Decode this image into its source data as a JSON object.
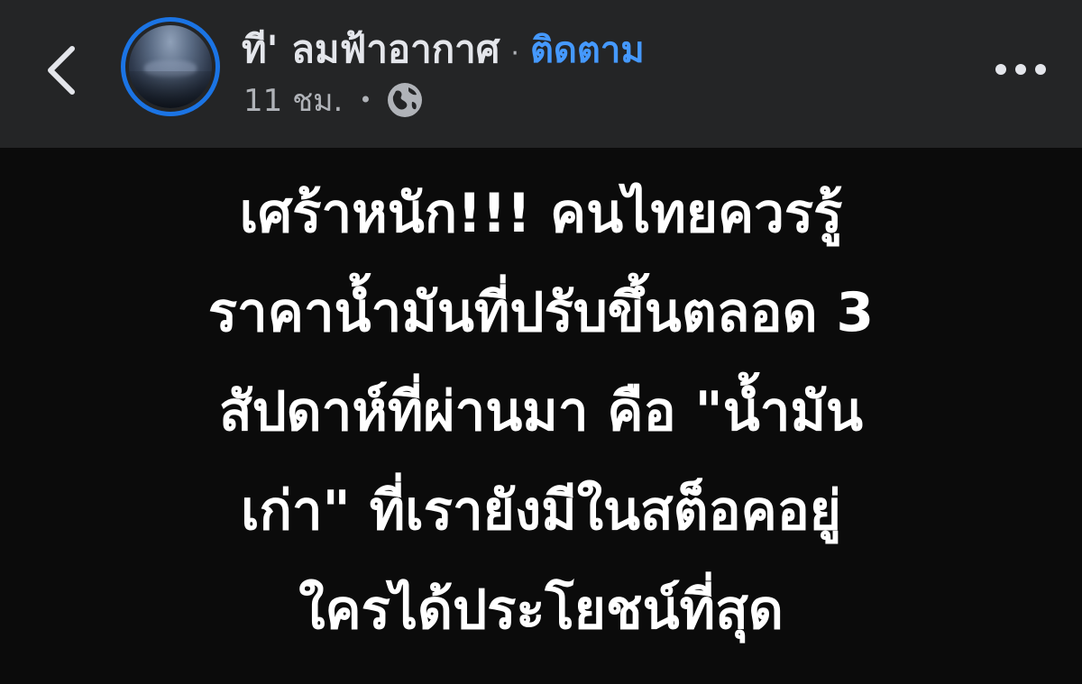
{
  "header": {
    "page_name": "ที' ลมฟ้าอากาศ",
    "separator": "·",
    "follow_label": "ติดตาม",
    "timestamp": "11 ชม.",
    "meta_separator": "•",
    "audience_icon": "globe-icon",
    "back_icon": "chevron-left-icon",
    "more_icon": "more-horizontal-icon",
    "avatar_ring_color": "#1b74e4",
    "follow_color": "#4599ff"
  },
  "post": {
    "lines": [
      "เศร้าหนัก!!! คนไทยควรรู้",
      "ราคาน้ำมันที่ปรับขึ้นตลอด 3",
      "สัปดาห์ที่ผ่านมา คือ \"น้ำมัน",
      "เก่า\" ที่เรายังมีในสต็อคอยู่",
      "ใครได้ประโยชน์ที่สุด"
    ],
    "background_color": "#0b0b0b",
    "text_color": "#ffffff"
  }
}
